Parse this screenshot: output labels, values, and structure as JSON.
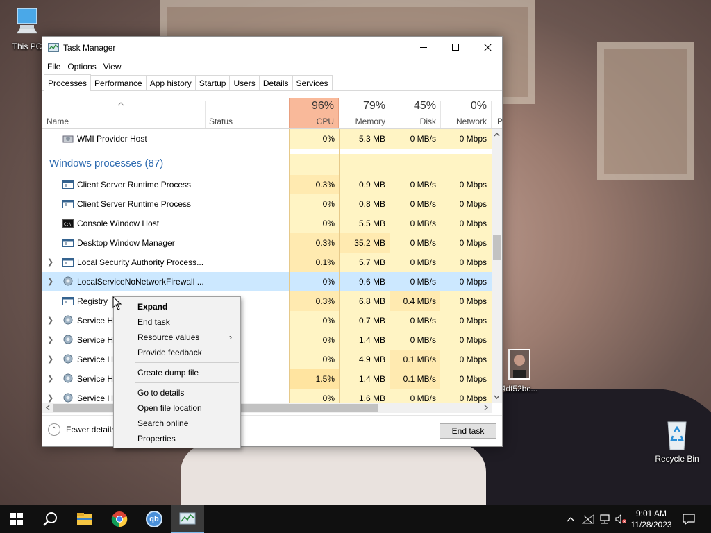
{
  "desktop": {
    "icons": [
      {
        "label": "This PC",
        "icon": "this-pc-icon"
      },
      {
        "label": "Recycle Bin",
        "icon": "recycle-bin-icon"
      },
      {
        "label": "4df52bc...",
        "icon": "image-file-icon"
      }
    ]
  },
  "window": {
    "title": "Task Manager",
    "menu": [
      "File",
      "Options",
      "View"
    ],
    "tabs": [
      "Processes",
      "Performance",
      "App history",
      "Startup",
      "Users",
      "Details",
      "Services"
    ],
    "active_tab": "Processes"
  },
  "columns": {
    "name": "Name",
    "status": "Status",
    "cpu": {
      "pct": "96%",
      "label": "CPU"
    },
    "memory": {
      "pct": "79%",
      "label": "Memory"
    },
    "disk": {
      "pct": "45%",
      "label": "Disk"
    },
    "network": {
      "pct": "0%",
      "label": "Network"
    },
    "partial": "P"
  },
  "group_label": "Windows processes (87)",
  "rows": [
    {
      "name": "WMI Provider Host",
      "cpu": "0%",
      "memory": "5.3 MB",
      "disk": "0 MB/s",
      "network": "0 Mbps",
      "expand": false,
      "icon": "wmi-icon"
    },
    {
      "name": "Client Server Runtime Process",
      "cpu": "0.3%",
      "memory": "0.9 MB",
      "disk": "0 MB/s",
      "network": "0 Mbps",
      "expand": false,
      "icon": "process-icon"
    },
    {
      "name": "Client Server Runtime Process",
      "cpu": "0%",
      "memory": "0.8 MB",
      "disk": "0 MB/s",
      "network": "0 Mbps",
      "expand": false,
      "icon": "process-icon"
    },
    {
      "name": "Console Window Host",
      "cpu": "0%",
      "memory": "5.5 MB",
      "disk": "0 MB/s",
      "network": "0 Mbps",
      "expand": false,
      "icon": "console-icon"
    },
    {
      "name": "Desktop Window Manager",
      "cpu": "0.3%",
      "memory": "35.2 MB",
      "disk": "0 MB/s",
      "network": "0 Mbps",
      "expand": false,
      "icon": "process-icon"
    },
    {
      "name": "Local Security Authority Process...",
      "cpu": "0.1%",
      "memory": "5.7 MB",
      "disk": "0 MB/s",
      "network": "0 Mbps",
      "expand": true,
      "icon": "process-icon"
    },
    {
      "name": "LocalServiceNoNetworkFirewall ...",
      "cpu": "0%",
      "memory": "9.6 MB",
      "disk": "0 MB/s",
      "network": "0 Mbps",
      "expand": true,
      "icon": "gear-icon",
      "selected": true
    },
    {
      "name": "Registry",
      "cpu": "0.3%",
      "memory": "6.8 MB",
      "disk": "0.4 MB/s",
      "network": "0 Mbps",
      "expand": false,
      "icon": "process-icon"
    },
    {
      "name": "Service Ho",
      "cpu": "0%",
      "memory": "0.7 MB",
      "disk": "0 MB/s",
      "network": "0 Mbps",
      "expand": true,
      "icon": "gear-icon"
    },
    {
      "name": "Service Ho",
      "cpu": "0%",
      "memory": "1.4 MB",
      "disk": "0 MB/s",
      "network": "0 Mbps",
      "expand": true,
      "icon": "gear-icon"
    },
    {
      "name": "Service Ho",
      "cpu": "0%",
      "memory": "4.9 MB",
      "disk": "0.1 MB/s",
      "network": "0 Mbps",
      "expand": true,
      "icon": "gear-icon"
    },
    {
      "name": "Service Ho",
      "cpu": "1.5%",
      "memory": "1.4 MB",
      "disk": "0.1 MB/s",
      "network": "0 Mbps",
      "expand": true,
      "icon": "gear-icon"
    },
    {
      "name": "Service Ho",
      "cpu": "0%",
      "memory": "1.6 MB",
      "disk": "0 MB/s",
      "network": "0 Mbps",
      "expand": true,
      "icon": "gear-icon"
    }
  ],
  "footer": {
    "fewer_details": "Fewer details",
    "end_task": "End task"
  },
  "context_menu": [
    {
      "label": "Expand",
      "bold": true
    },
    {
      "label": "End task"
    },
    {
      "label": "Resource values",
      "submenu": true
    },
    {
      "label": "Provide feedback"
    },
    {
      "separator": true
    },
    {
      "label": "Create dump file"
    },
    {
      "separator": true
    },
    {
      "label": "Go to details"
    },
    {
      "label": "Open file location"
    },
    {
      "label": "Search online"
    },
    {
      "label": "Properties"
    }
  ],
  "taskbar": {
    "apps": [
      "start-icon",
      "search-icon",
      "file-explorer-icon",
      "chrome-icon",
      "qbittorrent-icon",
      "task-manager-icon"
    ],
    "qb_label": "qb",
    "time": "9:01 AM",
    "date": "11/28/2023"
  },
  "colors": {
    "cpu_header": "#f9b99a",
    "heat_light": "#fff4c4",
    "heat_medium": "#ffeab0",
    "selected_row": "#cce8ff",
    "group_text": "#2e6bb0"
  }
}
